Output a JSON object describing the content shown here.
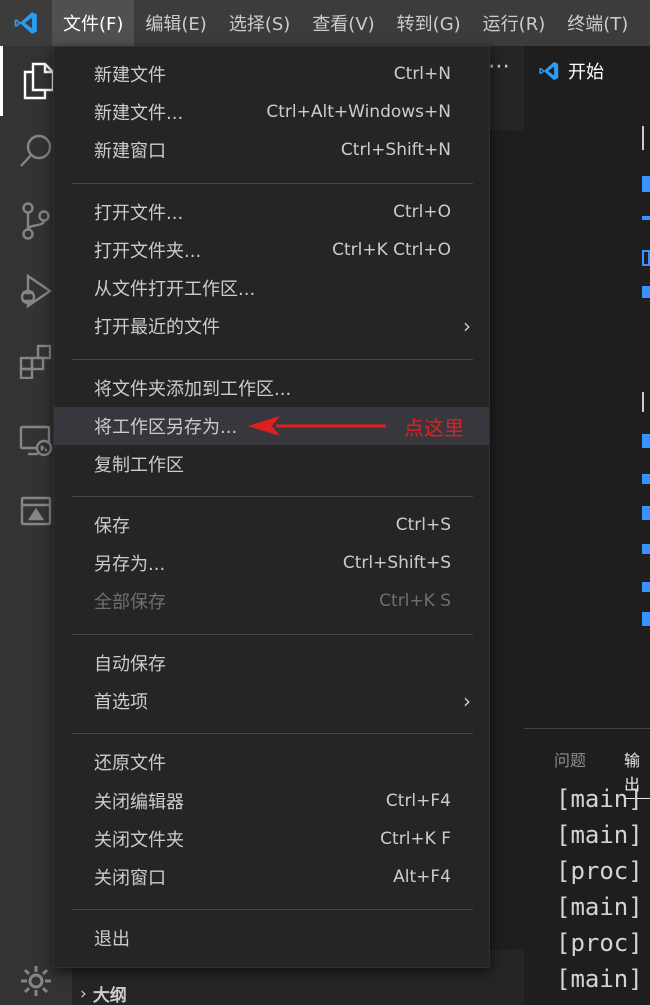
{
  "menubar": {
    "items": [
      "文件(F)",
      "编辑(E)",
      "选择(S)",
      "查看(V)",
      "转到(G)",
      "运行(R)",
      "终端(T)"
    ],
    "active_index": 0
  },
  "activitybar": {
    "icons": [
      "files-icon",
      "search-icon",
      "source-control-icon",
      "run-debug-icon",
      "extensions-icon",
      "remote-explorer-icon",
      "image-preview-icon",
      "settings-gear-icon"
    ]
  },
  "editor": {
    "tab_label": "开始"
  },
  "sidebar": {
    "outline_label": "大纲"
  },
  "panel": {
    "tabs": [
      "问题",
      "输出"
    ],
    "active_tab": "输出",
    "lines": [
      "[main]",
      "[main]",
      "[proc]",
      "[main]",
      "[proc]",
      "[main]"
    ]
  },
  "file_menu": {
    "groups": [
      [
        {
          "label": "新建文件",
          "shortcut": "Ctrl+N"
        },
        {
          "label": "新建文件...",
          "shortcut": "Ctrl+Alt+Windows+N"
        },
        {
          "label": "新建窗口",
          "shortcut": "Ctrl+Shift+N"
        }
      ],
      [
        {
          "label": "打开文件...",
          "shortcut": "Ctrl+O"
        },
        {
          "label": "打开文件夹...",
          "shortcut": "Ctrl+K Ctrl+O"
        },
        {
          "label": "从文件打开工作区...",
          "shortcut": ""
        },
        {
          "label": "打开最近的文件",
          "shortcut": "",
          "submenu": true
        }
      ],
      [
        {
          "label": "将文件夹添加到工作区...",
          "shortcut": ""
        },
        {
          "label": "将工作区另存为...",
          "shortcut": "",
          "highlighted": true
        },
        {
          "label": "复制工作区",
          "shortcut": ""
        }
      ],
      [
        {
          "label": "保存",
          "shortcut": "Ctrl+S"
        },
        {
          "label": "另存为...",
          "shortcut": "Ctrl+Shift+S"
        },
        {
          "label": "全部保存",
          "shortcut": "Ctrl+K S",
          "disabled": true
        }
      ],
      [
        {
          "label": "自动保存",
          "shortcut": ""
        },
        {
          "label": "首选项",
          "shortcut": "",
          "submenu": true
        }
      ],
      [
        {
          "label": "还原文件",
          "shortcut": ""
        },
        {
          "label": "关闭编辑器",
          "shortcut": "Ctrl+F4"
        },
        {
          "label": "关闭文件夹",
          "shortcut": "Ctrl+K F"
        },
        {
          "label": "关闭窗口",
          "shortcut": "Alt+F4"
        }
      ],
      [
        {
          "label": "退出",
          "shortcut": ""
        }
      ]
    ]
  },
  "annotation": {
    "text": "点这里",
    "color": "#e02020"
  },
  "colors": {
    "accent": "#007acc",
    "titlebar": "#3c3c3c",
    "menu_bg": "#252526",
    "highlight_bg": "#37373d"
  }
}
